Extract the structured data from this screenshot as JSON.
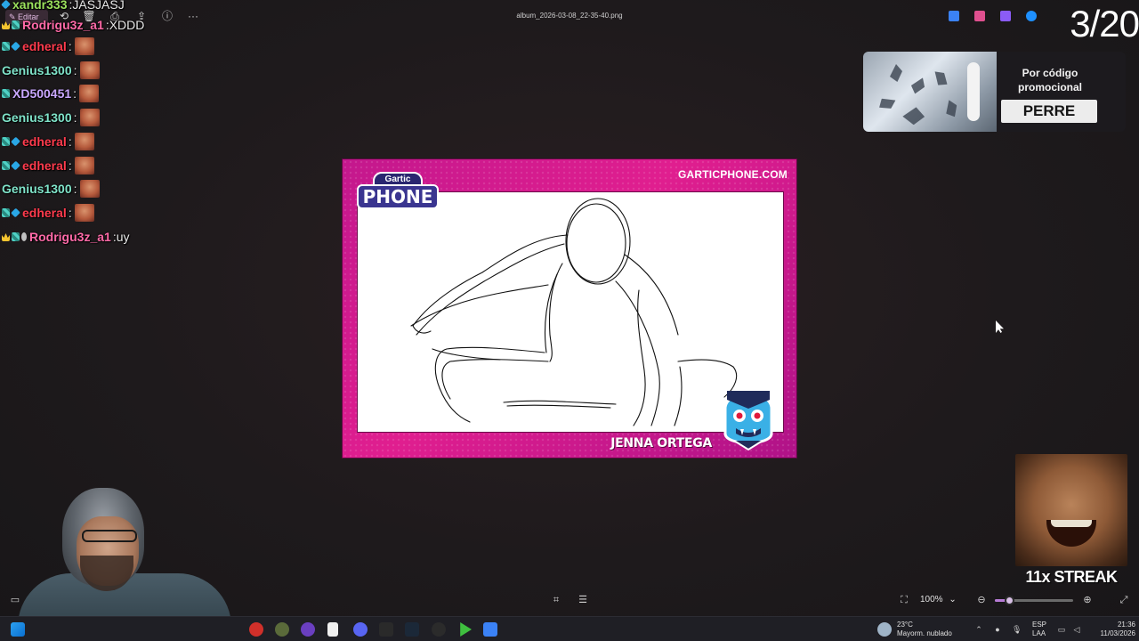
{
  "toolbar": {
    "edit_label": "Editar",
    "file_title": "album_2026-03-08_22-35-40.png",
    "more_label": "···"
  },
  "overlay": {
    "round_counter": "3/20"
  },
  "chat": {
    "messages": [
      {
        "user": "xandr333",
        "text": "JASJASJ",
        "color": "#9be15d",
        "emote": false
      },
      {
        "user": "Rodrigu3z_a1",
        "text": "XDDD",
        "color": "#ff6aa8",
        "emote": false
      },
      {
        "user": "edheral",
        "text": "",
        "color": "#ff3b4d",
        "emote": true
      },
      {
        "user": "Genius1300",
        "text": "",
        "color": "#7fe3c9",
        "emote": true
      },
      {
        "user": "XD500451",
        "text": "",
        "color": "#c9a7ff",
        "emote": true
      },
      {
        "user": "Genius1300",
        "text": "",
        "color": "#7fe3c9",
        "emote": true
      },
      {
        "user": "edheral",
        "text": "",
        "color": "#ff3b4d",
        "emote": true
      },
      {
        "user": "edheral",
        "text": "",
        "color": "#ff3b4d",
        "emote": true
      },
      {
        "user": "Genius1300",
        "text": "",
        "color": "#7fe3c9",
        "emote": true
      },
      {
        "user": "edheral",
        "text": "",
        "color": "#ff3b4d",
        "emote": true
      },
      {
        "user": "Rodrigu3z_a1",
        "text": "uy",
        "color": "#ff6aa8",
        "emote": false
      }
    ]
  },
  "promo": {
    "line1": "Por código",
    "line2": "promocional",
    "code": "PERRE"
  },
  "card": {
    "url": "GARTICPHONE.COM",
    "logo_top": "Gartic",
    "logo_main": "PHONE",
    "answer": "JENNA ORTEGA"
  },
  "streak": {
    "label": "11x STREAK"
  },
  "viewer": {
    "zoom": "100%",
    "zoom_fraction": 0.18
  },
  "taskbar": {
    "weather_temp": "23°C",
    "weather_desc": "Mayorm. nublado",
    "lang_1": "ESP",
    "lang_2": "LAA",
    "time": "21:36",
    "date": "11/03/2026"
  },
  "colors": {
    "card_magenta": "#d4198e",
    "accent": "#b77bd6"
  }
}
